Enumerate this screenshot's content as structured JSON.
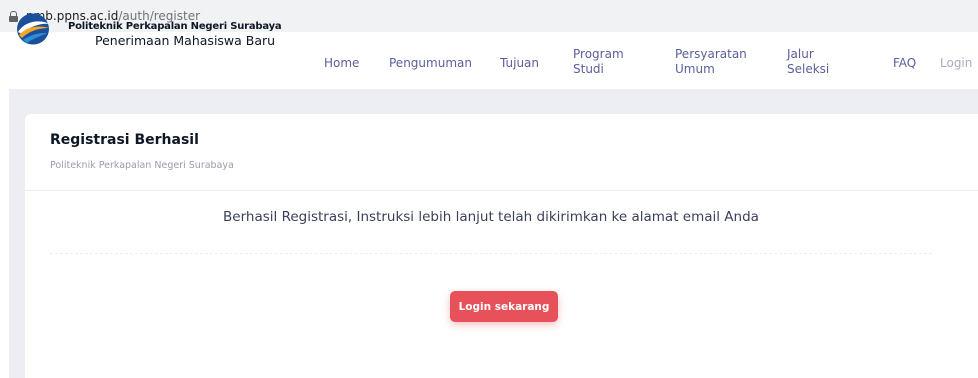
{
  "browser": {
    "url_host": "pmb.ppns.ac.id",
    "url_path": "/auth/register"
  },
  "header": {
    "brand_title": "Politeknik Perkapalan Negeri Surabaya",
    "brand_subtitle": "Penerimaan Mahasiswa Baru",
    "nav": [
      {
        "label": "Home"
      },
      {
        "label": "Pengumuman"
      },
      {
        "label": "Tujuan"
      },
      {
        "line1": "Program",
        "line2": "Studi"
      },
      {
        "line1": "Persyaratan",
        "line2": "Umum"
      },
      {
        "line1": "Jalur",
        "line2": "Seleksi"
      },
      {
        "label": "FAQ"
      },
      {
        "label": "Login"
      }
    ]
  },
  "card": {
    "title": "Registrasi Berhasil",
    "subtitle": "Politeknik Perkapalan Negeri Surabaya",
    "message": "Berhasil Registrasi, Instruksi lebih lanjut telah dikirimkan ke alamat email Anda",
    "button_label": "Login sekarang"
  },
  "colors": {
    "accent": "#e7515a",
    "nav_text": "#5b5f9a",
    "page_bg": "#edeef3"
  },
  "icons": {
    "lock": "lock-icon",
    "logo": "ppns-logo"
  }
}
